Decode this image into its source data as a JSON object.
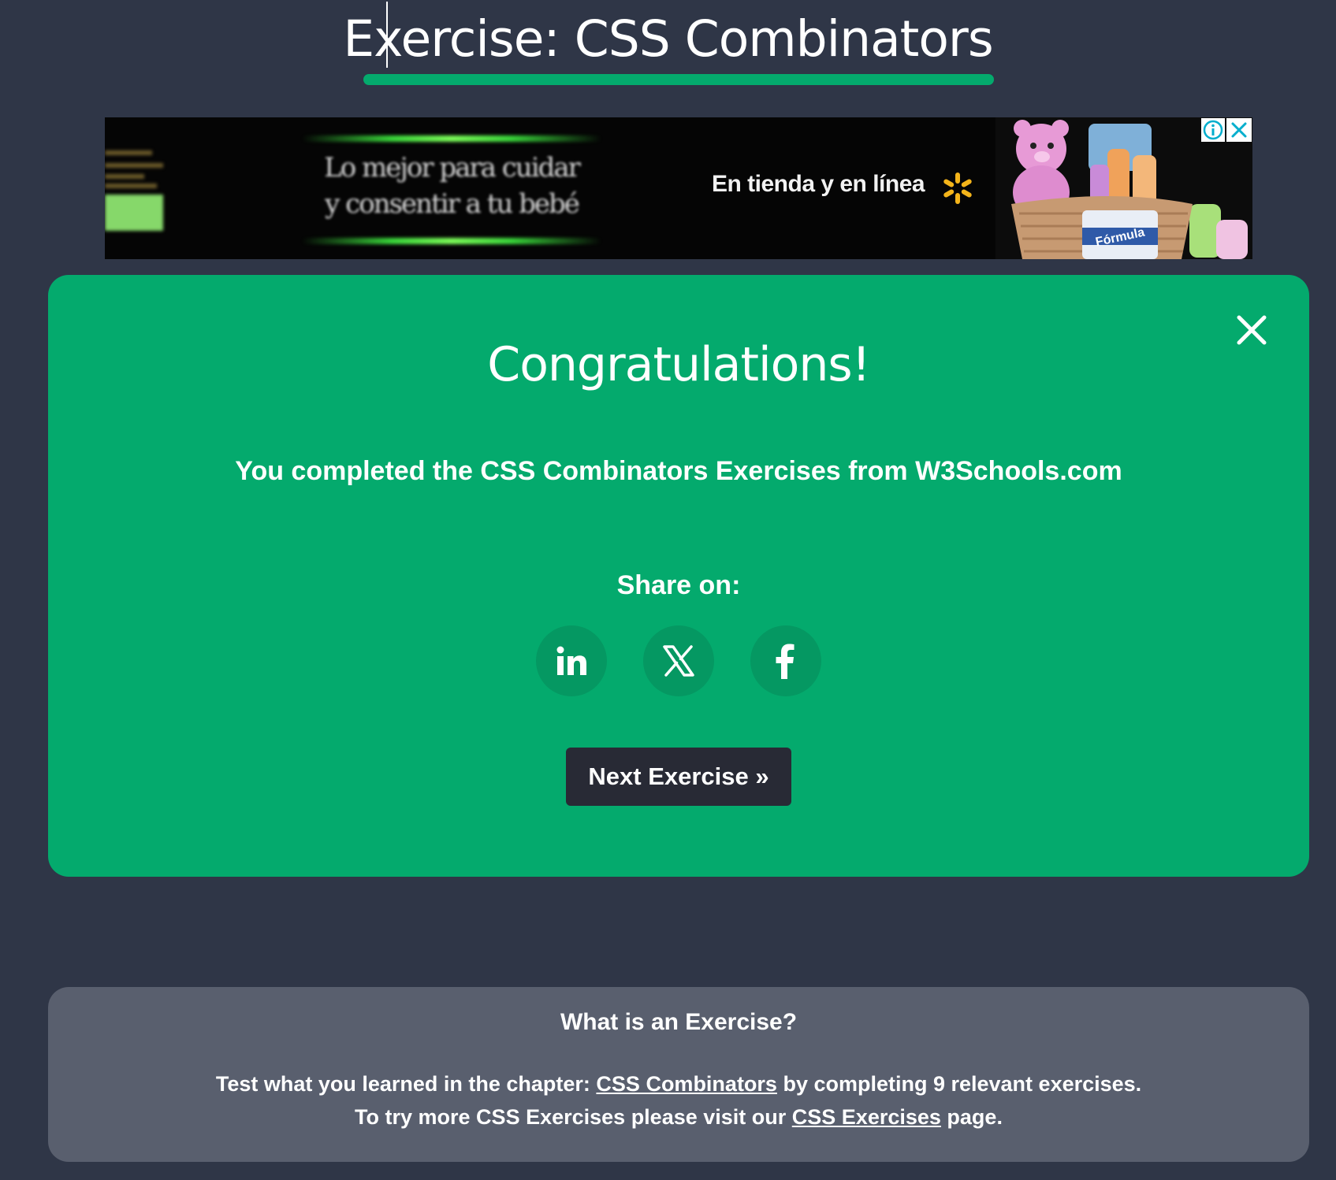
{
  "header": {
    "title": "Exercise: CSS Combinators"
  },
  "ad": {
    "headline_line1": "Lo mejor para cuidar",
    "headline_line2": "y consentir a tu bebé",
    "tagline": "En tienda y en línea",
    "product_label": "Fórmula"
  },
  "congrats": {
    "title": "Congratulations!",
    "message": "You completed the CSS Combinators Exercises from W3Schools.com",
    "share_label": "Share on:",
    "share": [
      {
        "network": "LinkedIn",
        "icon": "linkedin-icon"
      },
      {
        "network": "X",
        "icon": "x-icon"
      },
      {
        "network": "Facebook",
        "icon": "facebook-icon"
      }
    ],
    "next_button": "Next Exercise »"
  },
  "info": {
    "title": "What is an Exercise?",
    "line1_prefix": "Test what you learned in the chapter: ",
    "line1_link": "CSS Combinators",
    "line1_suffix": " by completing 9 relevant exercises.",
    "line2_prefix": "To try more CSS Exercises please visit our ",
    "line2_link": "CSS Exercises",
    "line2_suffix": " page."
  },
  "colors": {
    "background": "#2f3647",
    "accent": "#04aa6d",
    "button_dark": "#282a35",
    "info_box": "#595f6e"
  }
}
